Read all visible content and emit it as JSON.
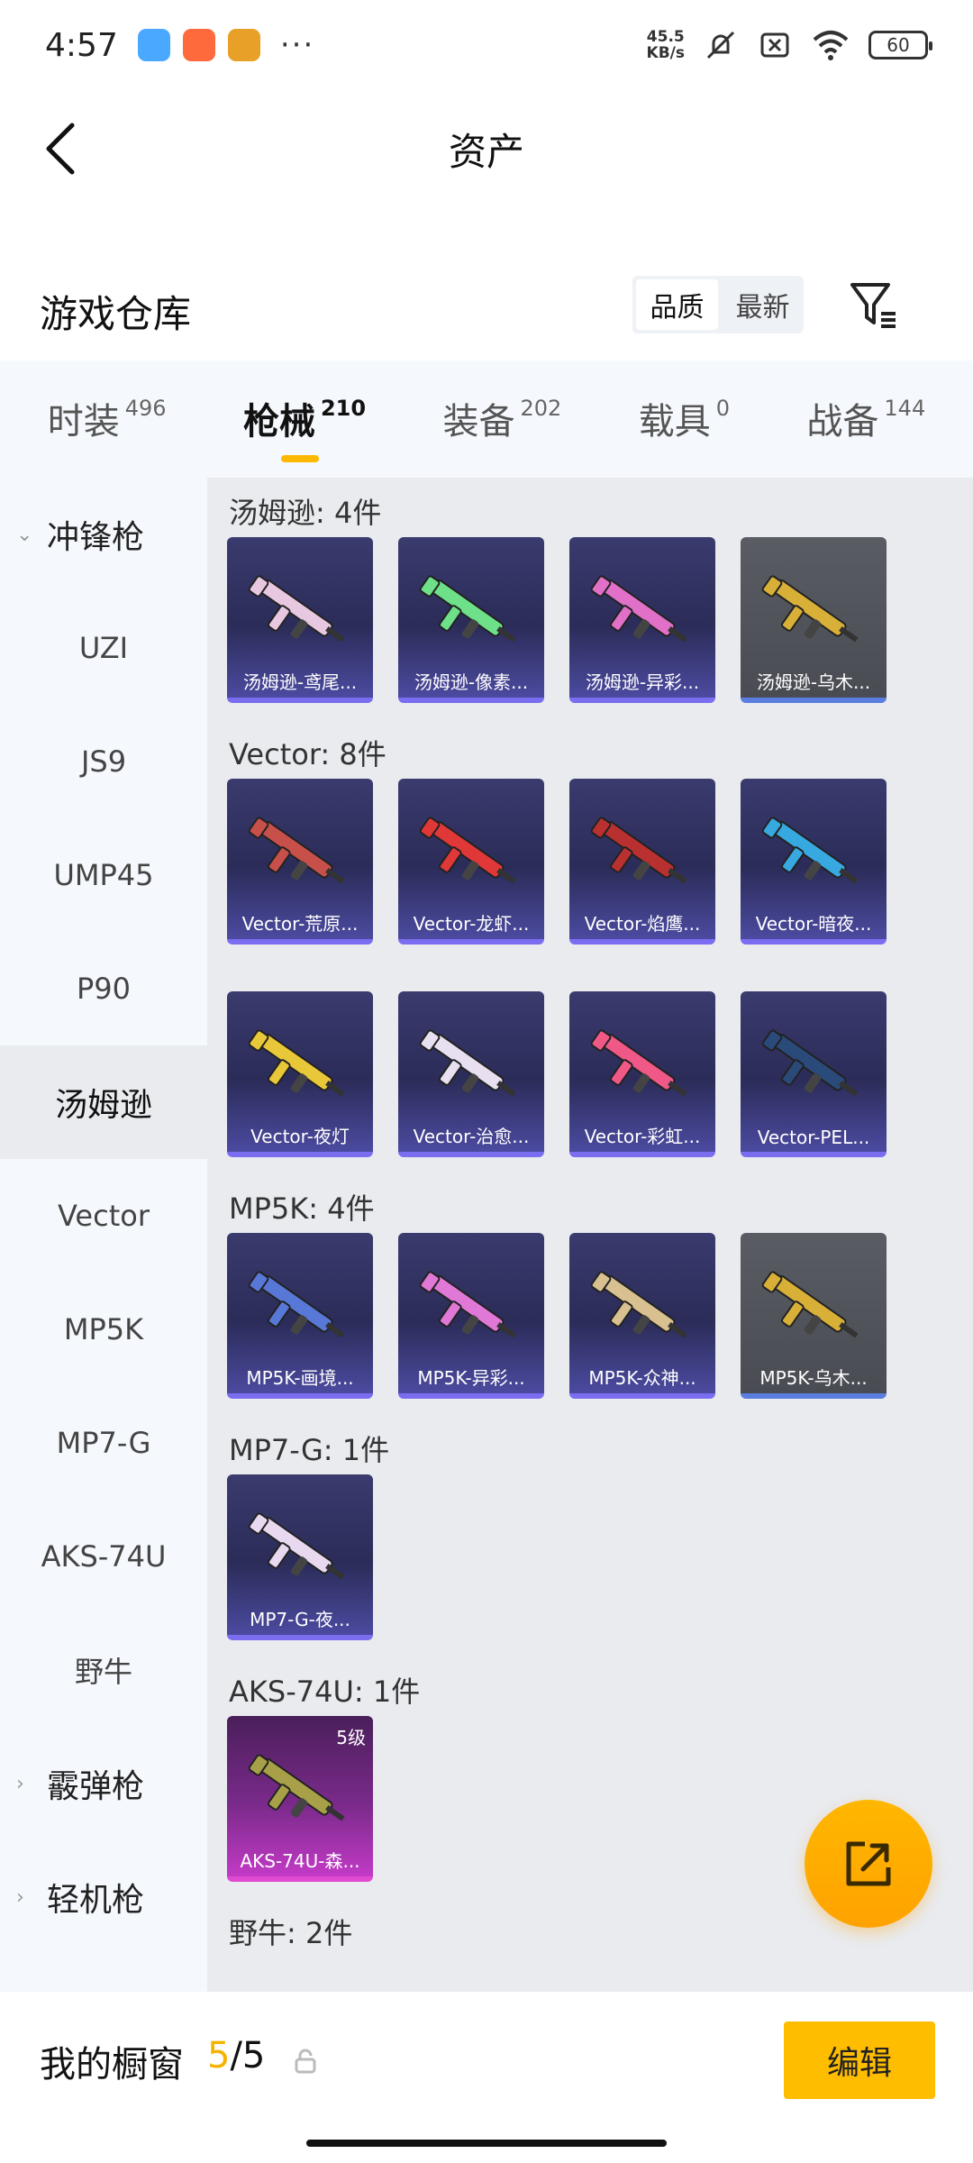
{
  "status": {
    "time": "4:57",
    "net_speed_top": "45.5",
    "net_speed_bottom": "KB/s",
    "battery": "60",
    "more": "···"
  },
  "header": {
    "title": "资产"
  },
  "warehouse": {
    "title": "游戏仓库",
    "sort_options": [
      "品质",
      "最新"
    ],
    "sort_selected": "品质"
  },
  "tabs": [
    {
      "label": "时装",
      "count": "496"
    },
    {
      "label": "枪械",
      "count": "210"
    },
    {
      "label": "装备",
      "count": "202"
    },
    {
      "label": "载具",
      "count": "0"
    },
    {
      "label": "战备",
      "count": "144"
    }
  ],
  "sidebar": {
    "items": [
      {
        "label": "冲锋枪",
        "type": "category"
      },
      {
        "label": "UZI"
      },
      {
        "label": "JS9"
      },
      {
        "label": "UMP45"
      },
      {
        "label": "P90"
      },
      {
        "label": "汤姆逊",
        "active": true
      },
      {
        "label": "Vector"
      },
      {
        "label": "MP5K"
      },
      {
        "label": "MP7-G"
      },
      {
        "label": "AKS-74U"
      },
      {
        "label": "野牛"
      },
      {
        "label": "霰弹枪",
        "type": "category"
      },
      {
        "label": "轻机枪",
        "type": "category"
      }
    ]
  },
  "groups": [
    {
      "title": "汤姆逊: 4件",
      "items": [
        {
          "name": "汤姆逊-鸢尾...",
          "style": "purple",
          "gun_color": "#e8c8e0"
        },
        {
          "name": "汤姆逊-像素...",
          "style": "purple",
          "gun_color": "#6ee08a"
        },
        {
          "name": "汤姆逊-异彩...",
          "style": "purple",
          "gun_color": "#e070c8"
        },
        {
          "name": "汤姆逊-乌木...",
          "style": "gray",
          "gun_color": "#d8b038"
        }
      ]
    },
    {
      "title": "Vector: 8件",
      "items": [
        {
          "name": "Vector-荒原...",
          "style": "purple",
          "gun_color": "#c8504a"
        },
        {
          "name": "Vector-龙虾...",
          "style": "purple",
          "gun_color": "#e03838"
        },
        {
          "name": "Vector-焰鹰...",
          "style": "purple",
          "gun_color": "#b83030"
        },
        {
          "name": "Vector-暗夜...",
          "style": "purple",
          "gun_color": "#38a8e0"
        },
        {
          "name": "Vector-夜灯",
          "style": "purple",
          "gun_color": "#e8c838"
        },
        {
          "name": "Vector-治愈...",
          "style": "purple",
          "gun_color": "#e8e0f0"
        },
        {
          "name": "Vector-彩虹...",
          "style": "purple",
          "gun_color": "#f05888"
        },
        {
          "name": "Vector-PEL...",
          "style": "purple",
          "gun_color": "#2a4a7a"
        }
      ]
    },
    {
      "title": "MP5K: 4件",
      "items": [
        {
          "name": "MP5K-画境...",
          "style": "purple",
          "gun_color": "#5878d8"
        },
        {
          "name": "MP5K-异彩...",
          "style": "purple",
          "gun_color": "#e078d8"
        },
        {
          "name": "MP5K-众神...",
          "style": "purple",
          "gun_color": "#d8c090"
        },
        {
          "name": "MP5K-乌木...",
          "style": "gray",
          "gun_color": "#d8b038"
        }
      ]
    },
    {
      "title": "MP7-G: 1件",
      "items": [
        {
          "name": "MP7-G-夜...",
          "style": "purple",
          "gun_color": "#e8d8f0"
        }
      ]
    },
    {
      "title": "AKS-74U: 1件",
      "items": [
        {
          "name": "AKS-74U-森...",
          "style": "pink",
          "gun_color": "#a8a048",
          "level": "5级"
        }
      ]
    },
    {
      "title": "野牛: 2件",
      "items": []
    }
  ],
  "bottom": {
    "label": "我的橱窗",
    "count_current": "5",
    "count_total": "/5",
    "edit_label": "编辑"
  }
}
